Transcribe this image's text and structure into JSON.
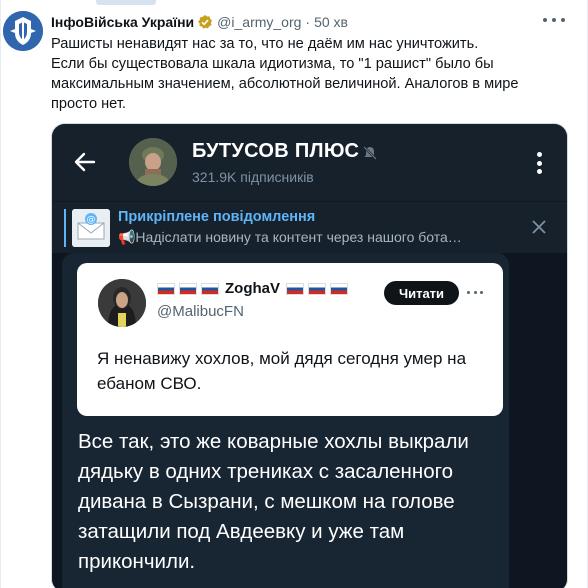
{
  "tweet": {
    "author": "ІнфоВійська України",
    "handle": "@i_army_org",
    "separator": "·",
    "time": "50 хв",
    "lines": [
      "Рашисты ненавидят нас за то, что не даём им нас уничтожить.",
      "Если бы существовала шкала идиотизма, то \"1 рашист\" было бы",
      "максимальным значением, абсолютной величиной. Аналогов в мире",
      "просто нет."
    ]
  },
  "telegram": {
    "channel_name": "БУТУСОВ ПЛЮС",
    "subscribers": "321.9K підписників",
    "pinned_title": "Прикріплене повідомлення",
    "pinned_text": "📢Надіслати новину та контент через нашого бота…",
    "quote": {
      "name": "ZoghaV",
      "handle": "@MalibucFN",
      "follow_label": "Читати",
      "text": "Я ненавижу хохлов, мой дядя сегодня умер на ебаном СВО."
    },
    "message_text": "Все так, это же коварные хохлы выкрали дядьку в одних трениках с засаленного дивана в Сызрани, с мешком на голове затащили под Авдеевку и уже там прикончили."
  },
  "icons": {
    "tweet_avatar": "army-emblem-icon",
    "back": "arrow-left-icon",
    "mute": "muted-bell-icon",
    "menu": "more-vertical-icon",
    "close": "close-icon",
    "flags": "russian-flag-icon"
  },
  "colors": {
    "telegram_bg": "#17212b",
    "telegram_accent": "#5eb5f7",
    "bubble": "#182533",
    "tweet_blue_avatar": "#2f66ad"
  }
}
